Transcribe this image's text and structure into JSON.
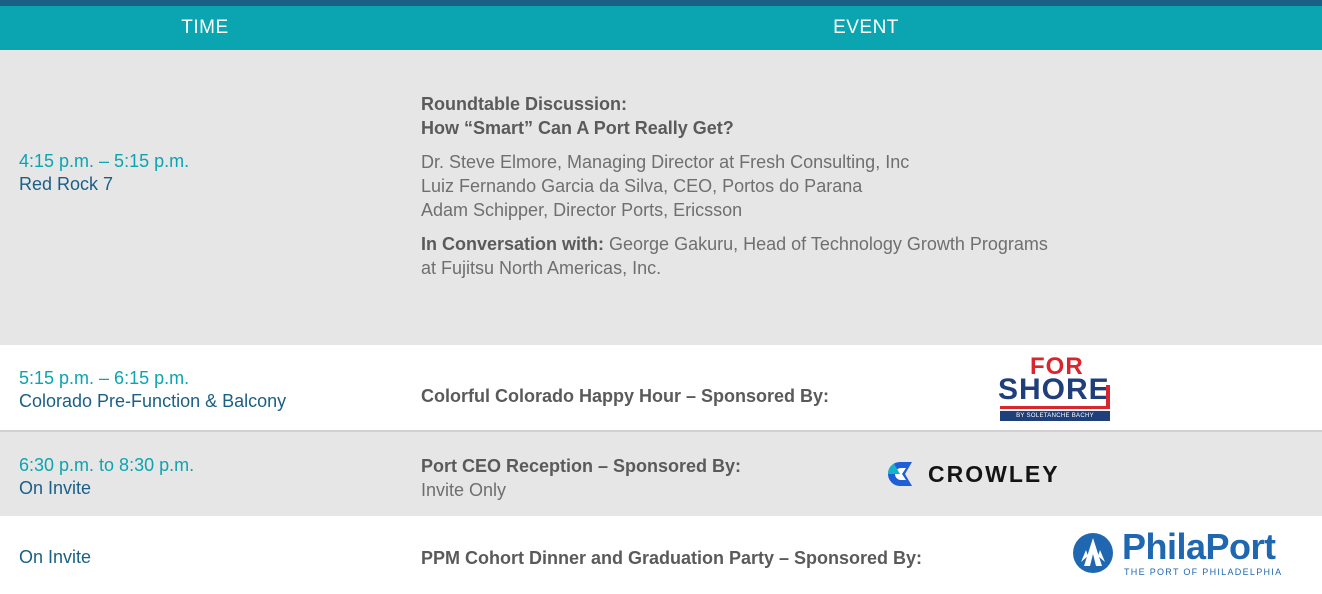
{
  "header": {
    "time_label": "TIME",
    "event_label": "EVENT"
  },
  "rows": [
    {
      "time": "4:15 p.m. – 5:15 p.m.",
      "location": "Red Rock 7",
      "event_title_line1": "Roundtable Discussion:",
      "event_title_line2": "How “Smart” Can A Port Really Get?",
      "speakers": [
        "Dr. Steve Elmore, Managing Director at Fresh Consulting, Inc",
        "Luiz Fernando Garcia da Silva, CEO, Portos do Parana",
        "Adam Schipper, Director Ports, Ericsson"
      ],
      "moderator_label": "In Conversation with:",
      "moderator_line1": "George Gakuru, Head of Technology Growth Programs",
      "moderator_line2": "at Fujitsu North Americas, Inc."
    },
    {
      "time": "5:15 p.m. – 6:15 p.m.",
      "location": "Colorado Pre-Function & Balcony",
      "event_title": "Colorful Colorado Happy Hour – Sponsored By:",
      "sponsor_logo": {
        "line1": "FOR",
        "line2": "SHORE",
        "tagline": "BY SOLETANCHE BACHY"
      }
    },
    {
      "time": "6:30 p.m. to 8:30 p.m.",
      "location": "On Invite",
      "event_title": "Port CEO Reception – Sponsored By:",
      "event_note": "Invite Only",
      "sponsor_logo": {
        "name": "CROWLEY"
      }
    },
    {
      "location": "On Invite",
      "event_title": "PPM Cohort Dinner and Graduation Party – Sponsored By:",
      "sponsor_logo": {
        "name": "PhilaPort",
        "tagline": "THE PORT OF PHILADELPHIA"
      }
    }
  ],
  "colors": {
    "header_bg": "#0aa5b0",
    "top_line": "#1a5f86",
    "row_shade": "#e6e6e6",
    "time_teal": "#0aa5b0",
    "location_navy": "#1a5f86"
  }
}
